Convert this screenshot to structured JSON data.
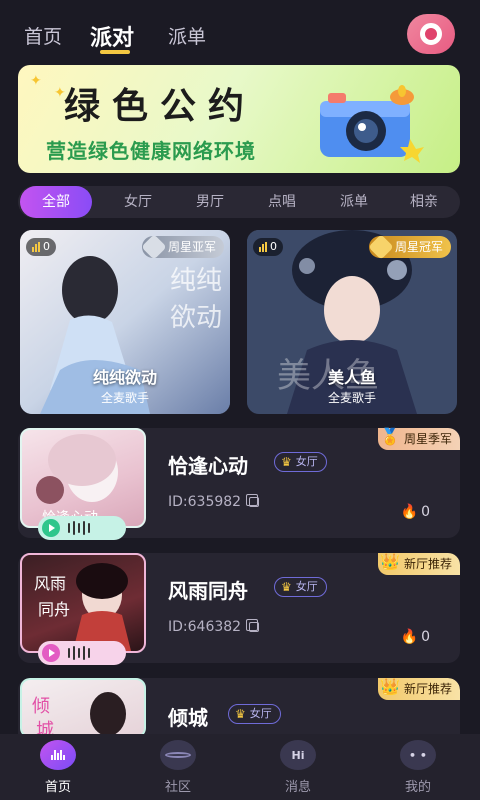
{
  "topnav": {
    "tabs": [
      {
        "label": "首页"
      },
      {
        "label": "派对"
      },
      {
        "label": "派单"
      }
    ],
    "active_tab": "派对"
  },
  "banner": {
    "title": "绿色公约",
    "subtitle": "营造绿色健康网络环境"
  },
  "categories": [
    "全部",
    "女厅",
    "男厅",
    "点唱",
    "派单",
    "相亲"
  ],
  "featured": [
    {
      "count": "0",
      "rank": "周星亚军",
      "name": "纯纯欲动",
      "sub": "全麦歌手",
      "art": "纯纯欲动"
    },
    {
      "count": "0",
      "rank": "周星冠军",
      "name": "美人鱼",
      "sub": "全麦歌手",
      "art": "美人鱼"
    }
  ],
  "rooms": [
    {
      "name": "恰逢心动",
      "tag": "女厅",
      "id": "ID:635982",
      "heat": "0",
      "ribbon": "周星季军",
      "art": "恰逢心动"
    },
    {
      "name": "风雨同舟",
      "tag": "女厅",
      "id": "ID:646382",
      "heat": "0",
      "ribbon": "新厅推荐",
      "art": "风雨同舟"
    },
    {
      "name": "倾城",
      "tag": "女厅",
      "id": "",
      "heat": "",
      "ribbon": "新厅推荐",
      "art": "倾城"
    }
  ],
  "tabbar": [
    {
      "label": "首页"
    },
    {
      "label": "社区"
    },
    {
      "label": "消息",
      "icon_text": "Hi"
    },
    {
      "label": "我的"
    }
  ]
}
